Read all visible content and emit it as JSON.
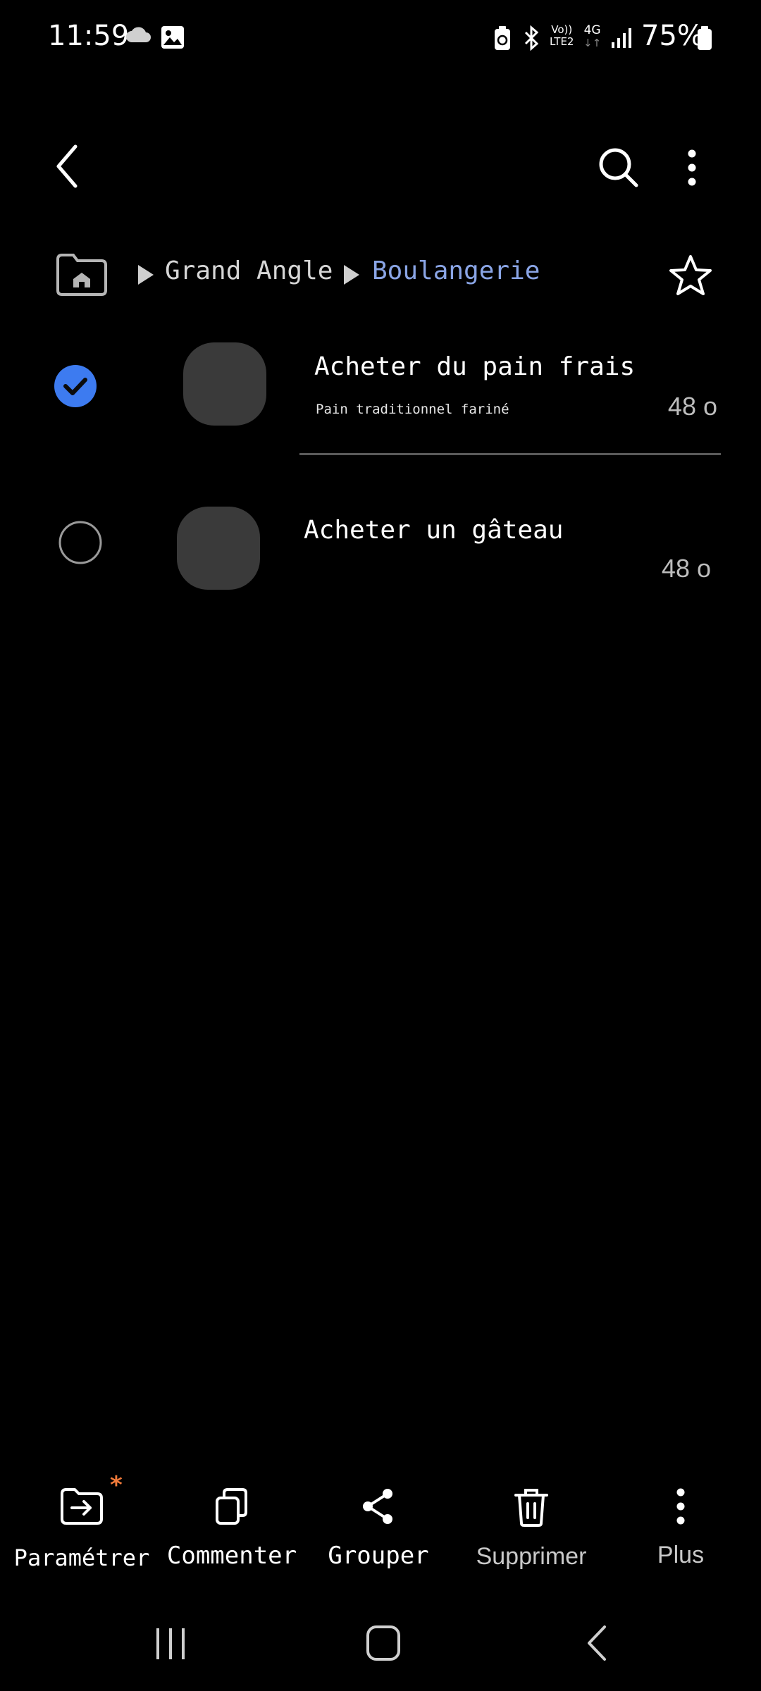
{
  "status_bar": {
    "time": "11:59",
    "volte_label_top": "Vo))",
    "volte_label_bottom": "LTE2",
    "network_type": "4G",
    "battery_percent": "75%"
  },
  "breadcrumb": {
    "items": [
      {
        "label": "Grand Angle"
      },
      {
        "label": "Boulangerie"
      }
    ],
    "active_color": "#8aa5e6"
  },
  "list": {
    "items": [
      {
        "title": "Acheter du pain frais",
        "subtitle": "Pain traditionnel fariné",
        "size": "48 o",
        "selected": true
      },
      {
        "title": "Acheter un gâteau",
        "subtitle": "",
        "size": "48 o",
        "selected": false
      }
    ]
  },
  "actions": {
    "move_label": "Paramétrer",
    "copy_label": "Commenter",
    "share_label": "Grouper",
    "delete_label": "Supprimer",
    "more_label": "Plus"
  },
  "colors": {
    "accent": "#3d7bf0",
    "badge": "#f07a3a"
  }
}
